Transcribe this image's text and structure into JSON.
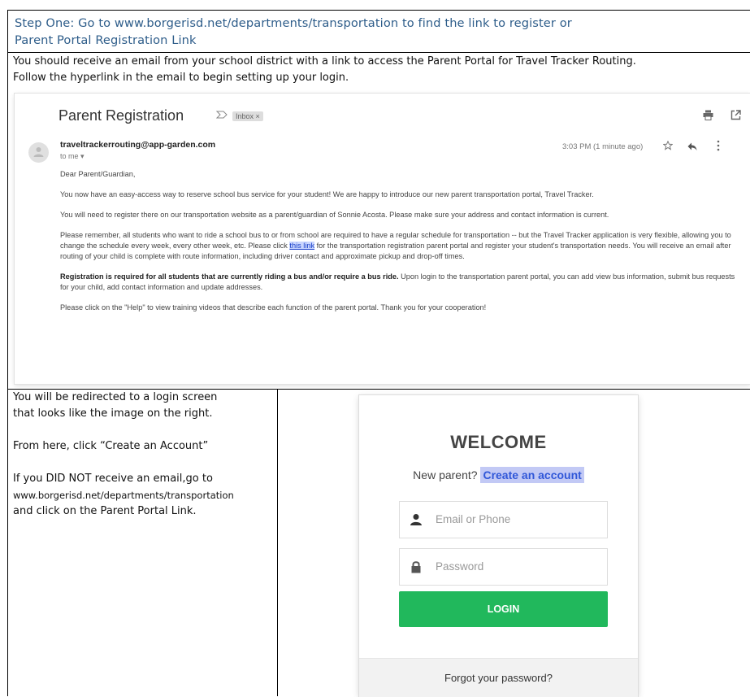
{
  "step": {
    "line1": "Step One: Go to www.borgerisd.net/departments/transportation to find the link to register or",
    "line2": "Parent Portal Registration Link"
  },
  "intro": {
    "line1": "You should receive an email from your school district with a link to access the Parent Portal for Travel Tracker Routing.",
    "line2": "Follow the hyperlink in the email to begin setting up your login."
  },
  "email": {
    "subject": "Parent Registration",
    "label": "Inbox ×",
    "sender": "traveltrackerrouting@app-garden.com",
    "to": "to me ▾",
    "time": "3:03 PM (1 minute ago)",
    "greeting": "Dear Parent/Guardian,",
    "p1": "You now have an easy-access way to reserve school bus service for your student! We are happy to introduce our new parent transportation portal, Travel Tracker.",
    "p2": "You will need to register there on our transportation website as a parent/guardian of Sonnie Acosta. Please make sure your address and contact information is current.",
    "p3_before": "Please remember, all students who want to ride a school bus to or from school are required to have a regular schedule for transportation -- but the Travel Tracker application is very flexible, allowing you to change the schedule every week, every other week, etc. Please click ",
    "p3_link": "this link",
    "p3_after": " for the transportation registration parent portal and register your student's transportation needs. You will receive an email after routing of your child is complete with route information, including driver contact and approximate pickup and drop-off times.",
    "p4_bold": "Registration is required for all students that are currently riding a bus and/or require a bus ride.",
    "p4_rest": " Upon login to the transportation parent portal, you can add view bus information, submit bus requests for your child, add contact information and update addresses.",
    "p5": "Please click on the \"Help\" to view training videos that describe each function of the parent portal. Thank you for your cooperation!"
  },
  "left": {
    "l1": "You will be redirected to a login screen",
    "l2": "that looks like the image on the right.",
    "l3": "From here, click “Create an Account”",
    "l4": "If you DID NOT receive an email,go to",
    "l5": "www.borgerisd.net/departments/transportation",
    "l6": "and click on the Parent Portal Link."
  },
  "login": {
    "welcome": "WELCOME",
    "new_parent": "New parent?",
    "create": "Create an account",
    "email_placeholder": "Email or Phone",
    "password_placeholder": "Password",
    "login_button": "LOGIN",
    "forgot": "Forgot your password?"
  }
}
